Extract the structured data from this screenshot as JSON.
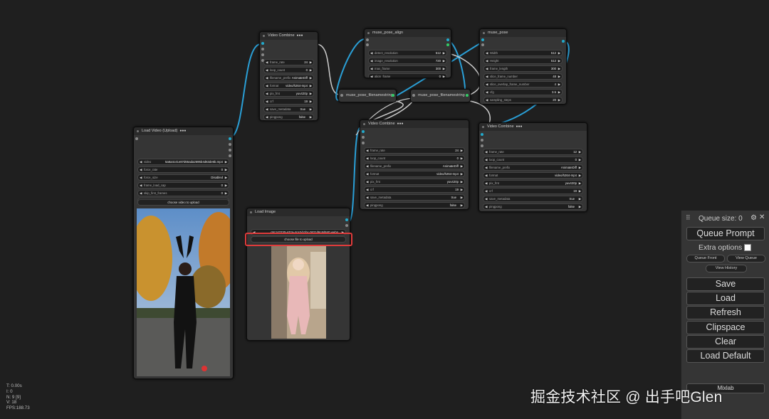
{
  "nodes": {
    "vc1": {
      "title": "Video Combine",
      "widgets": [
        {
          "label": "frame_rate",
          "value": "24"
        },
        {
          "label": "loop_count",
          "value": "0"
        },
        {
          "label": "filename_prefix",
          "value": "AnimateDiff"
        },
        {
          "label": "format",
          "value": "video/h264-mp4"
        },
        {
          "label": "pix_fmt",
          "value": "yuv420p"
        },
        {
          "label": "crf",
          "value": "19"
        },
        {
          "label": "save_metadata",
          "value": "true"
        },
        {
          "label": "pingpong",
          "value": "false"
        },
        {
          "label": "save_output",
          "value": "true"
        }
      ]
    },
    "mpa": {
      "title": "muse_pose_align",
      "widgets": [
        {
          "label": "detect_resolution",
          "value": "512"
        },
        {
          "label": "image_resolution",
          "value": "720"
        },
        {
          "label": "max_frame",
          "value": "300"
        },
        {
          "label": "align_frame",
          "value": "0"
        }
      ]
    },
    "mp": {
      "title": "muse_pose",
      "widgets": [
        {
          "label": "Width",
          "value": "512"
        },
        {
          "label": "Height",
          "value": "512"
        },
        {
          "label": "frame_length",
          "value": "300"
        },
        {
          "label": "slice_frame_number",
          "value": "48"
        },
        {
          "label": "slice_overlap_frame_number",
          "value": "4"
        },
        {
          "label": "cfg",
          "value": "3.5"
        },
        {
          "label": "sampling_steps",
          "value": "20"
        },
        {
          "label": "fps",
          "value": "12"
        }
      ]
    },
    "fr1": {
      "title": "muse_pose_filenamestring"
    },
    "fr2": {
      "title": "muse_pose_filenamestring"
    },
    "lv": {
      "title": "Load Video (Upload)",
      "widgets": [
        {
          "label": "video",
          "value": "5a6a4c41e87d65ada2695b4d63de6b.mp4"
        },
        {
          "label": "force_rate",
          "value": "0"
        },
        {
          "label": "force_size",
          "value": "Disabled"
        },
        {
          "label": "frame_load_cap",
          "value": "0"
        },
        {
          "label": "skip_first_frames",
          "value": "0"
        },
        {
          "label": "select_every_nth",
          "value": "1"
        }
      ],
      "upload_label": "choose video to upload"
    },
    "li": {
      "title": "Load Image",
      "image_name": "c8c142230-a32a-4ca3-b1bc-3621d6c6d640.webp",
      "upload_label": "choose file to upload"
    },
    "vc2": {
      "title": "Video Combine",
      "widgets": [
        {
          "label": "frame_rate",
          "value": "24"
        },
        {
          "label": "loop_count",
          "value": "0"
        },
        {
          "label": "filename_prefix",
          "value": "AnimateDiff"
        },
        {
          "label": "format",
          "value": "video/h264-mp4"
        },
        {
          "label": "pix_fmt",
          "value": "yuv420p"
        },
        {
          "label": "crf",
          "value": "19"
        },
        {
          "label": "save_metadata",
          "value": "true"
        },
        {
          "label": "pingpong",
          "value": "false"
        },
        {
          "label": "save_output",
          "value": "false"
        }
      ]
    },
    "vc3": {
      "title": "Video Combine",
      "widgets": [
        {
          "label": "frame_rate",
          "value": "12"
        },
        {
          "label": "loop_count",
          "value": "0"
        },
        {
          "label": "filename_prefix",
          "value": "AnimateDiff"
        },
        {
          "label": "format",
          "value": "video/h264-mp4"
        },
        {
          "label": "pix_fmt",
          "value": "yuv420p"
        },
        {
          "label": "crf",
          "value": "19"
        },
        {
          "label": "save_metadata",
          "value": "true"
        },
        {
          "label": "pingpong",
          "value": "false"
        },
        {
          "label": "save_output",
          "value": "false"
        }
      ]
    }
  },
  "queue": {
    "size_label": "Queue size: 0",
    "queue_prompt": "Queue Prompt",
    "extra_options": "Extra options",
    "queue_front": "Queue Front",
    "view_queue": "View Queue",
    "view_history": "View History",
    "save": "Save",
    "load": "Load",
    "refresh": "Refresh",
    "clipspace": "Clipspace",
    "clear": "Clear",
    "load_default": "Load Default",
    "mixlab": "Mixlab"
  },
  "stats": [
    "T: 0.00s",
    "I: 0",
    "N: 9 [9]",
    "V: 18",
    "FPS:188.73"
  ],
  "watermark": "掘金技术社区 @ 出手吧Glen",
  "colors": {
    "link": "#2a9fd6",
    "link_green": "#3c6",
    "highlight": "#e03b3b"
  }
}
